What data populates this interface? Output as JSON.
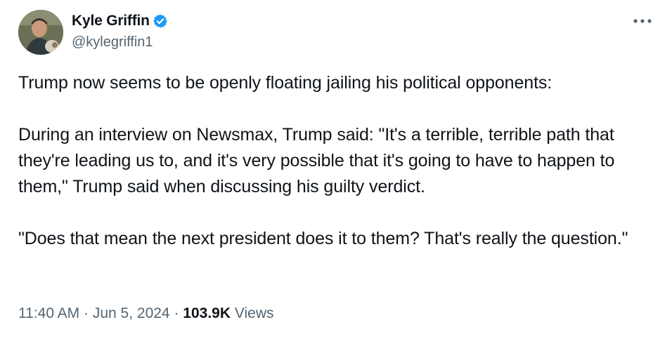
{
  "author": {
    "display_name": "Kyle Griffin",
    "handle": "@kylegriffin1",
    "verified": true,
    "verified_color": "#1d9bf0"
  },
  "icons": {
    "more": "more-options-icon",
    "verified": "verified-badge-icon"
  },
  "tweet": {
    "paragraphs": [
      "Trump now seems to be openly floating jailing his political opponents:",
      "During an interview on Newsmax, Trump said: \"It's a terrible, terrible path that they're leading us to, and it's very possible that it's going to have to happen to them,\" Trump said when discussing his guilty verdict.",
      "\"Does that mean the next president does it to them? That's really the question.\""
    ]
  },
  "meta": {
    "time": "11:40 AM",
    "separator": "·",
    "date": "Jun 5, 2024",
    "views_count": "103.9K",
    "views_label": "Views"
  },
  "colors": {
    "text": "#0f1419",
    "secondary": "#536471",
    "accent": "#1d9bf0"
  }
}
